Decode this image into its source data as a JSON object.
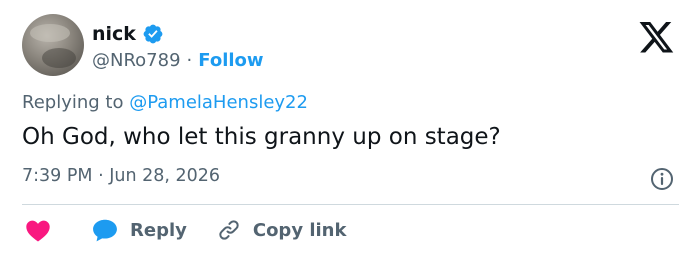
{
  "author": {
    "display_name": "nick",
    "handle": "@NRo789",
    "separator": "·",
    "follow_label": "Follow",
    "verified": true
  },
  "tweet": {
    "replying_prefix": "Replying to",
    "replying_to": "@PamelaHensley22",
    "text": "Oh God, who let this granny up on stage?",
    "timestamp": "7:39 PM · Jun 28, 2026"
  },
  "actions": {
    "reply_label": "Reply",
    "copy_link_label": "Copy link"
  },
  "icons": {
    "verified": "verified-badge-icon",
    "logo": "x-logo-icon",
    "info": "info-icon",
    "like": "heart-icon",
    "reply": "reply-bubble-icon",
    "copy": "link-icon"
  },
  "colors": {
    "accent": "#1d9bf0",
    "secondary_text": "#536471",
    "primary_text": "#0f1419",
    "like": "#f91880",
    "divider": "#cfd9de"
  }
}
